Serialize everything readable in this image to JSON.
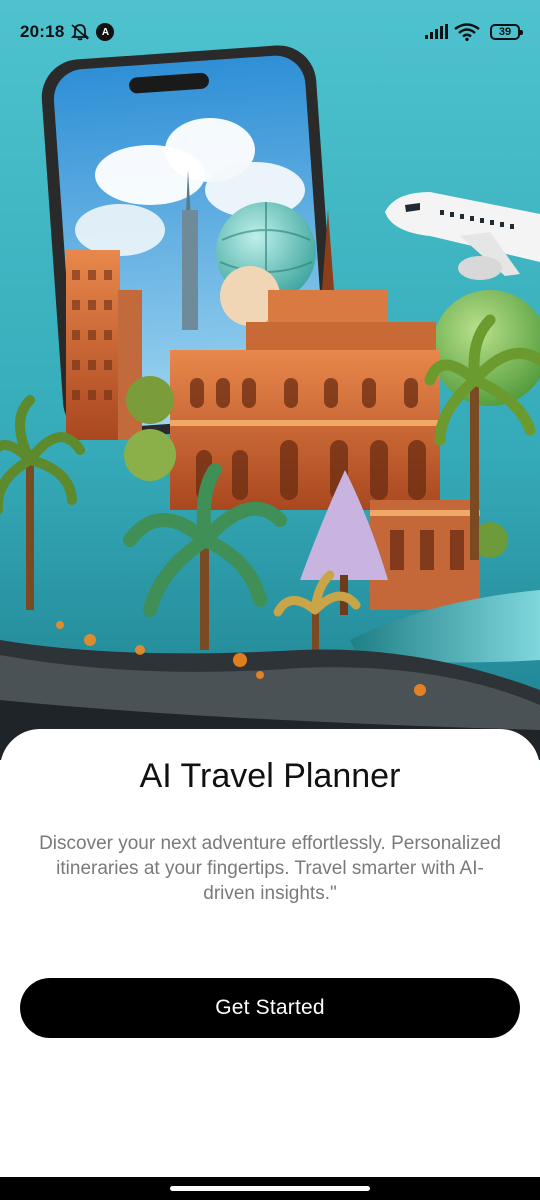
{
  "status_bar": {
    "time": "20:18",
    "nav_badge": "A",
    "battery": "39",
    "icons": [
      "mute-notification-icon",
      "navigation-badge-icon",
      "signal-icon",
      "wifi-icon",
      "battery-icon"
    ]
  },
  "hero": {
    "image": "travel-illustration",
    "colors": {
      "sky": "#3fb7c4",
      "building": "#c8643a",
      "accent": "#e89a4e"
    }
  },
  "content": {
    "title": "AI Travel Planner",
    "description": "Discover your next adventure effortlessly. Personalized itineraries at your fingertips. Travel smarter with AI-driven insights.\"",
    "cta_label": "Get Started"
  },
  "theme": {
    "button_bg": "#000000",
    "button_text": "#ffffff",
    "title_color": "#111111",
    "description_color": "#7a7a7a"
  }
}
